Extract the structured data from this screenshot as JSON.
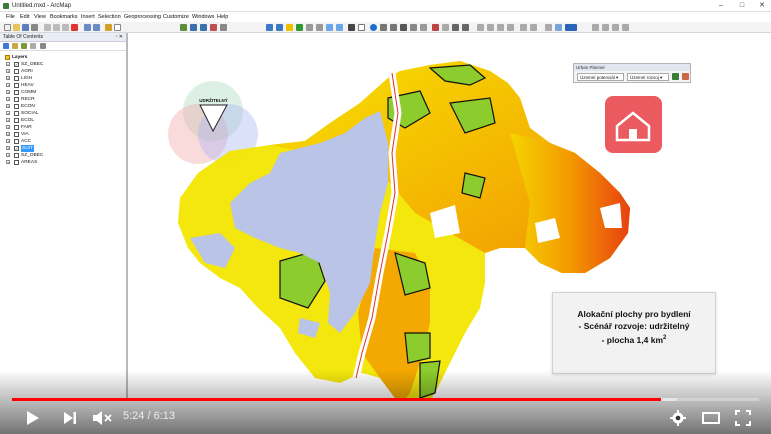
{
  "window": {
    "title": "Untitled.mxd - ArcMap",
    "controls": [
      "–",
      "□",
      "✕"
    ]
  },
  "menu": [
    "File",
    "Edit",
    "View",
    "Bookmarks",
    "Insert",
    "Selection",
    "Geoprocessing",
    "Customize",
    "Windows",
    "Help"
  ],
  "toc": {
    "title": "Table Of Contents",
    "pin": "▫ ✕",
    "root_label": "Layers",
    "layers": [
      {
        "label": "SZ_OBEC",
        "checked": true,
        "expand": "−"
      },
      {
        "label": "AGRI",
        "checked": false,
        "expand": "+"
      },
      {
        "label": "LIGH",
        "checked": false,
        "expand": "+"
      },
      {
        "label": "HEAV",
        "checked": false,
        "expand": "+"
      },
      {
        "label": "COMM",
        "checked": false,
        "expand": "+"
      },
      {
        "label": "RECR",
        "checked": false,
        "expand": "+"
      },
      {
        "label": "ECON",
        "checked": false,
        "expand": "+"
      },
      {
        "label": "SOCIAL",
        "checked": false,
        "expand": "+"
      },
      {
        "label": "ECOL",
        "checked": false,
        "expand": "+"
      },
      {
        "label": "FAIR",
        "checked": false,
        "expand": "+"
      },
      {
        "label": "VIA",
        "checked": false,
        "expand": "+"
      },
      {
        "label": "ACC",
        "checked": false,
        "expand": "+"
      },
      {
        "label": "SUIT",
        "checked": true,
        "expand": "+",
        "selected": true
      },
      {
        "label": "SZ_OBEC",
        "checked": false,
        "expand": "+"
      },
      {
        "label": "AREAS",
        "checked": false,
        "expand": "+"
      }
    ]
  },
  "urban_planner": {
    "title": "Urban Planner",
    "dropdown1": "Územní potenciál ▾",
    "dropdown2": "Územní rozvoj ▾"
  },
  "venn": {
    "center_label": "UDRŽITELNÝ"
  },
  "info": {
    "line1": "Alokační plochy pro bydlení",
    "line2": "- Scénář rozvoje: udržitelný",
    "line3": "- plocha 1,4 km",
    "line3_sup": "2"
  },
  "player": {
    "time": "5:24 / 6:13",
    "played_fraction": 0.869,
    "loaded_fraction": 0.89
  },
  "colors": {
    "accent_red": "#ff0000",
    "home_tile": "#ea5a5f"
  }
}
